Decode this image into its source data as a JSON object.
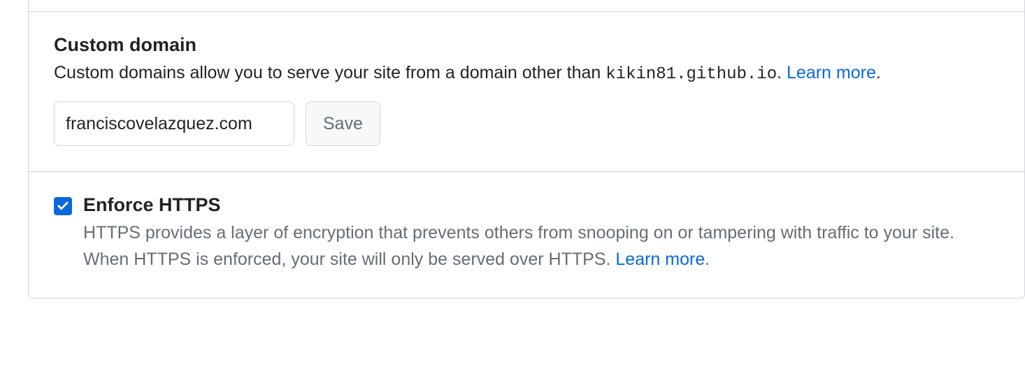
{
  "custom_domain": {
    "title": "Custom domain",
    "description_prefix": "Custom domains allow you to serve your site from a domain other than ",
    "default_domain": "kikin81.github.io",
    "description_suffix": ". ",
    "learn_more": "Learn more",
    "description_end": ".",
    "input_value": "franciscovelazquez.com",
    "save_button": "Save"
  },
  "enforce_https": {
    "checked": true,
    "label": "Enforce HTTPS",
    "description_line1": "HTTPS provides a layer of encryption that prevents others from snooping on or tampering with traffic to your site.",
    "description_line2_prefix": "When HTTPS is enforced, your site will only be served over HTTPS. ",
    "learn_more": "Learn more",
    "description_line2_suffix": "."
  }
}
